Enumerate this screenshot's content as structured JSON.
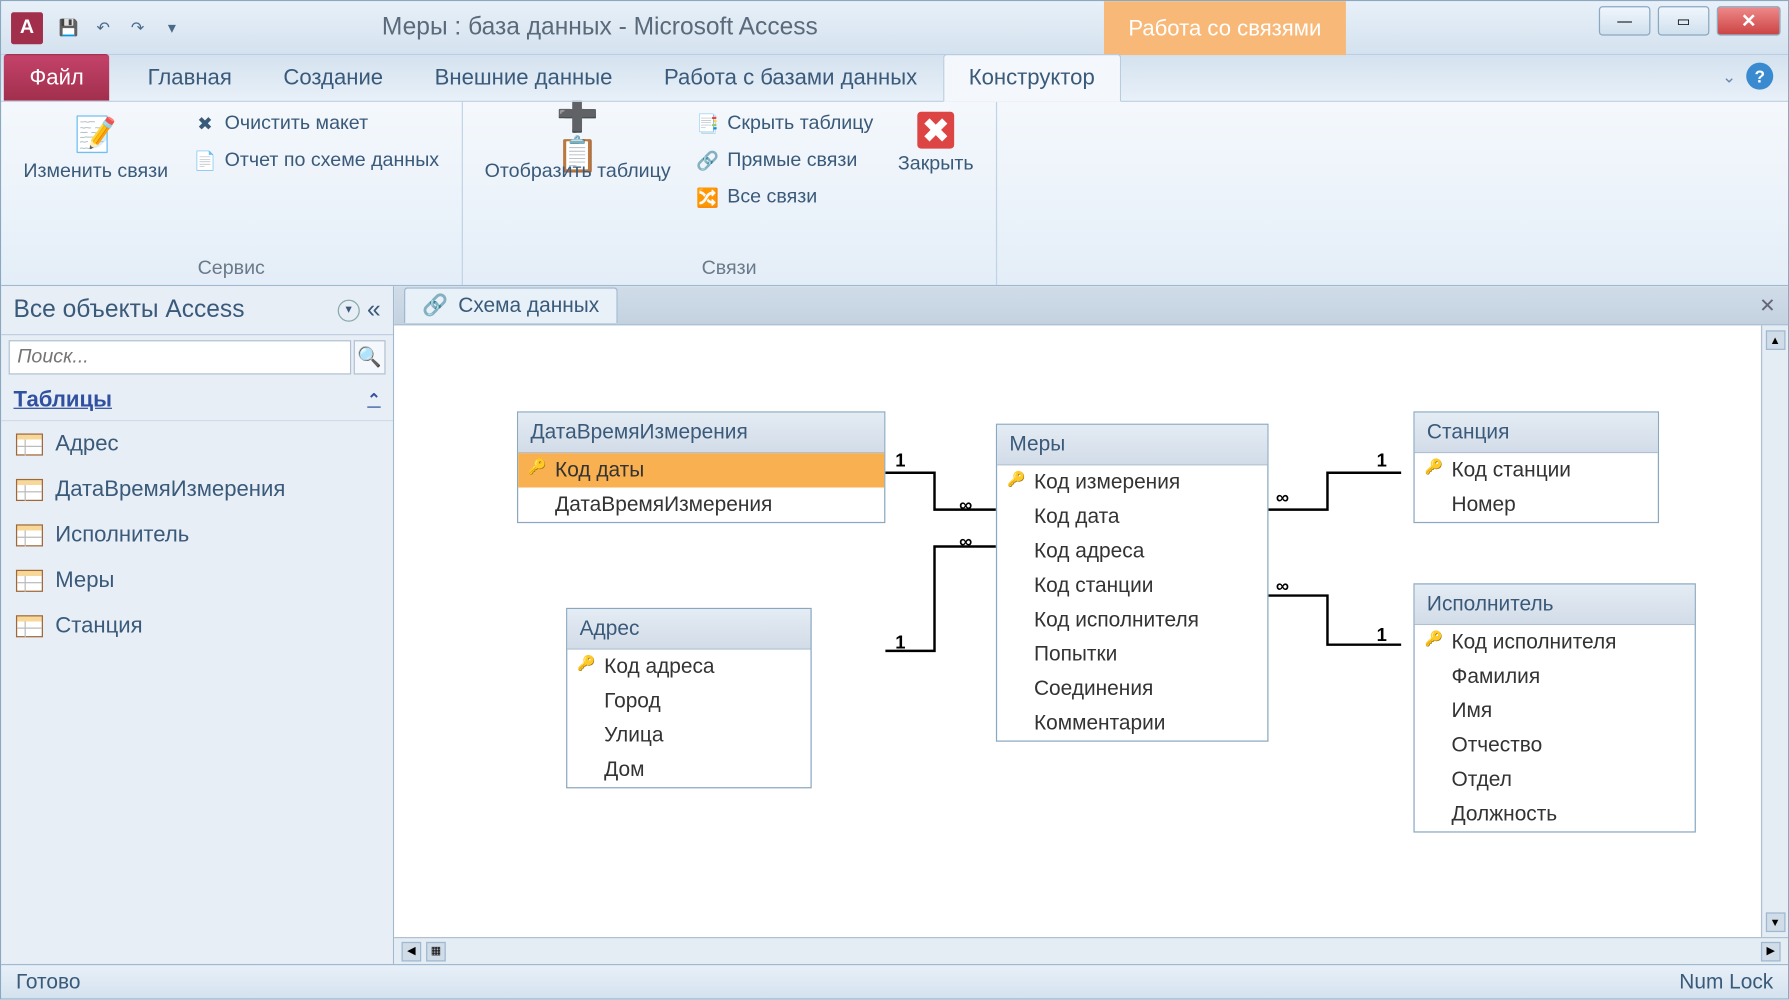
{
  "titlebar": {
    "title": "Меры : база данных  -  Microsoft Access",
    "contextual_label": "Работа со связями"
  },
  "ribbon": {
    "tabs": {
      "file": "Файл",
      "home": "Главная",
      "create": "Создание",
      "external": "Внешние данные",
      "dbtools": "Работа с базами данных",
      "designer": "Конструктор"
    },
    "groups": {
      "service": {
        "label": "Сервис",
        "edit_rel": "Изменить связи",
        "clear_layout": "Очистить макет",
        "rel_report": "Отчет по схеме данных"
      },
      "show_table": "Отобразить таблицу",
      "relations": {
        "label": "Связи",
        "hide_table": "Скрыть таблицу",
        "direct": "Прямые связи",
        "all": "Все связи"
      },
      "close": "Закрыть"
    }
  },
  "nav": {
    "header": "Все объекты Access",
    "search_placeholder": "Поиск...",
    "group_tables": "Таблицы",
    "items": [
      "Адрес",
      "ДатаВремяИзмерения",
      "Исполнитель",
      "Меры",
      "Станция"
    ]
  },
  "doc": {
    "tab": "Схема данных"
  },
  "tables": {
    "datetime": {
      "title": "ДатаВремяИзмерения",
      "fields": [
        "Код даты",
        "ДатаВремяИзмерения"
      ],
      "pk": [
        0
      ]
    },
    "address": {
      "title": "Адрес",
      "fields": [
        "Код адреса",
        "Город",
        "Улица",
        "Дом"
      ],
      "pk": [
        0
      ]
    },
    "measures": {
      "title": "Меры",
      "fields": [
        "Код измерения",
        "Код дата",
        "Код адреса",
        "Код станции",
        "Код исполнителя",
        "Попытки",
        "Соединения",
        "Комментарии"
      ],
      "pk": [
        0
      ]
    },
    "station": {
      "title": "Станция",
      "fields": [
        "Код станции",
        "Номер"
      ],
      "pk": [
        0
      ]
    },
    "executor": {
      "title": "Исполнитель",
      "fields": [
        "Код исполнителя",
        "Фамилия",
        "Имя",
        "Отчество",
        "Отдел",
        "Должность"
      ],
      "pk": [
        0
      ]
    }
  },
  "cardinality": {
    "one": "1",
    "many": "∞"
  },
  "status": {
    "ready": "Готово",
    "numlock": "Num Lock"
  }
}
